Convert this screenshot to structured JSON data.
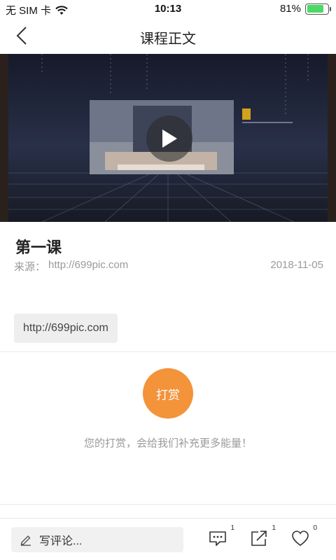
{
  "status_bar": {
    "carrier": "无 SIM 卡",
    "time": "10:13",
    "battery": "81%",
    "battery_level": 0.81,
    "wifi_icon": "wifi-icon",
    "battery_icon": "battery-icon"
  },
  "nav": {
    "title": "课程正文",
    "back_icon": "chevron-left-icon"
  },
  "video": {
    "play_icon": "play-icon"
  },
  "article": {
    "title": "第一课",
    "source_label": "来源：",
    "source_value": "http://699pic.com",
    "date": "2018-11-05",
    "link": "http://699pic.com"
  },
  "reward": {
    "button_label": "打赏",
    "tip": "您的打赏，会给我们补充更多能量！",
    "color": "#f3933a"
  },
  "bottom_bar": {
    "comment_placeholder": "写评论...",
    "comment_icon": "pencil-icon",
    "comments_count": "1",
    "shares_count": "1",
    "likes_count": "0"
  }
}
